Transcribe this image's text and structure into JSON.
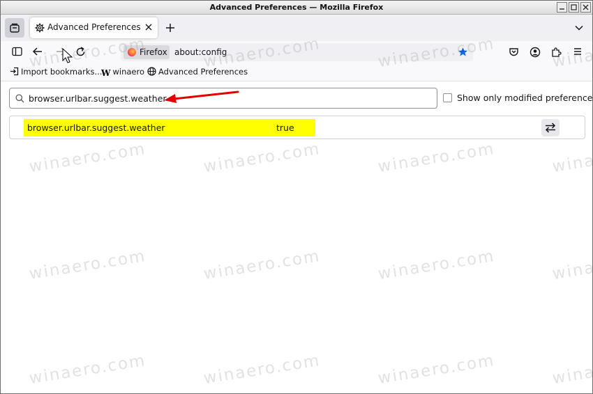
{
  "window": {
    "title": "Advanced Preferences — Mozilla Firefox"
  },
  "tabs": [
    {
      "label": "Advanced Preferences",
      "icon": "gear-icon",
      "active": true
    }
  ],
  "urlbar": {
    "identity_label": "Firefox",
    "url": "about:config"
  },
  "bookmarks": [
    {
      "label": "Import bookmarks...",
      "icon": "import-icon"
    },
    {
      "label": "winaero",
      "icon": "winaero-logo"
    },
    {
      "label": "Advanced Preferences",
      "icon": "globe-icon"
    }
  ],
  "config": {
    "search_value": "browser.urlbar.suggest.weather",
    "show_modified_label": "Show only modified preferences",
    "show_modified_checked": false,
    "preferences": [
      {
        "name": "browser.urlbar.suggest.weather",
        "value": "true"
      }
    ]
  },
  "watermark": "winaero.com",
  "colors": {
    "highlight": "#ffff00",
    "annotation_arrow": "#e00000",
    "bookmark_star": "#0060df"
  }
}
